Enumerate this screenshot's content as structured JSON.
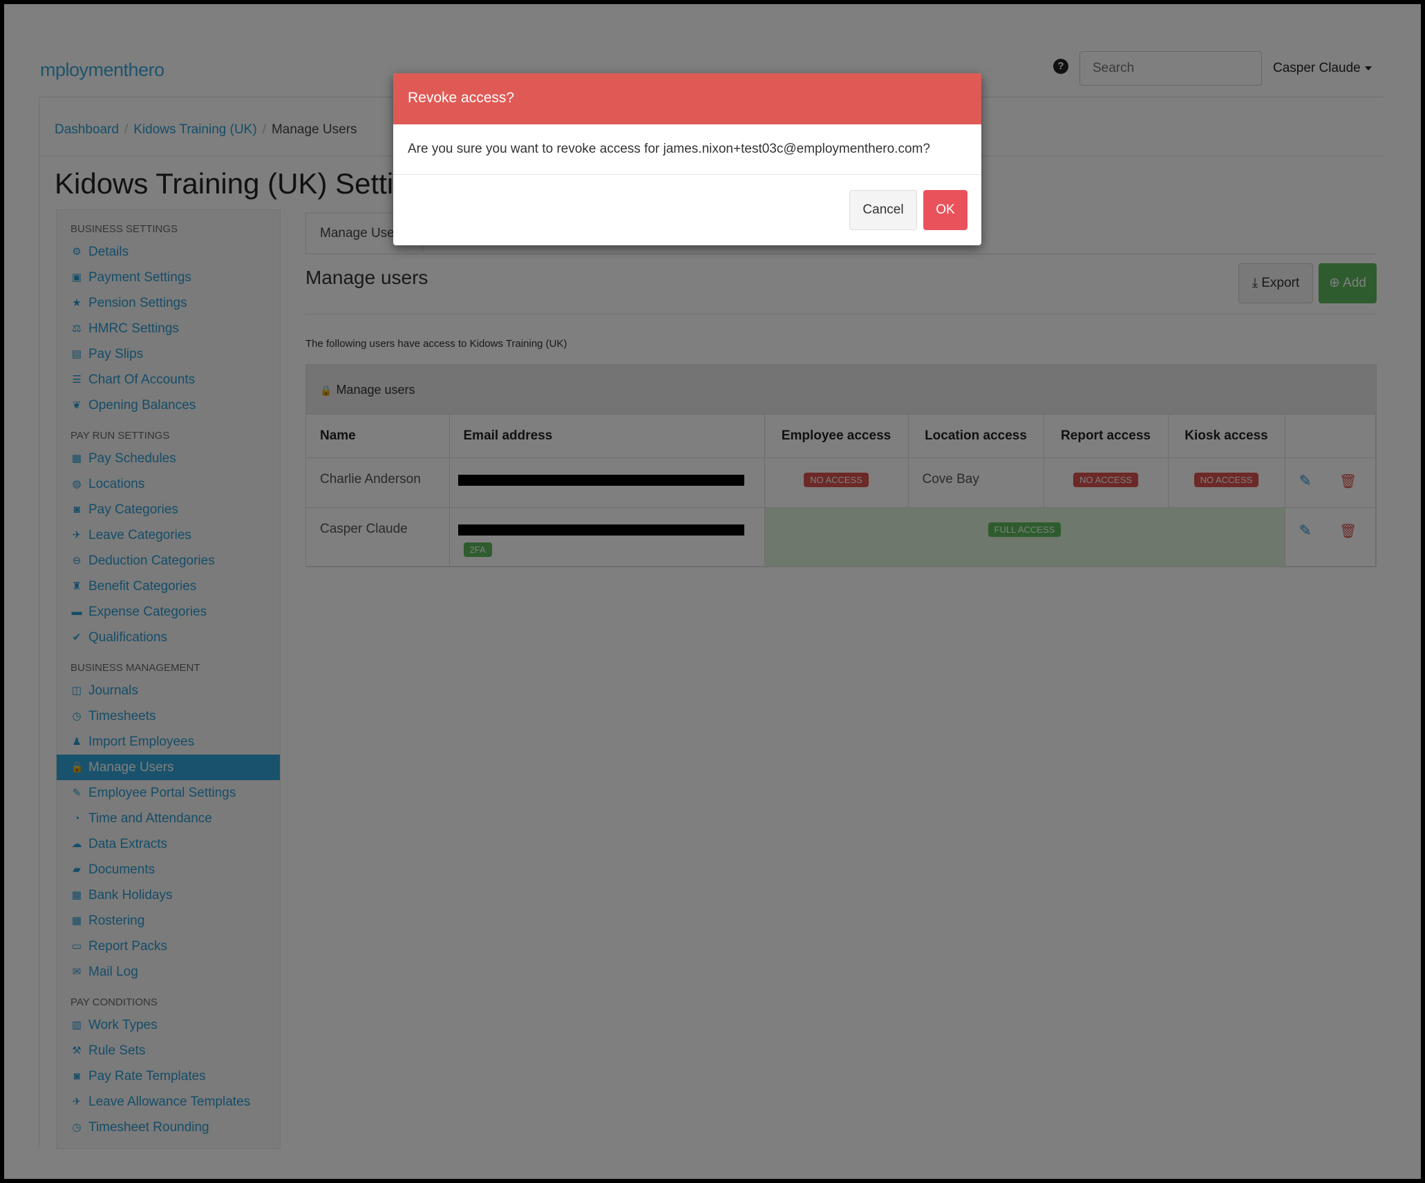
{
  "header": {
    "logo_text": "mploymenthero",
    "help_icon": "?",
    "search_placeholder": "Search",
    "user_name": "Casper Claude"
  },
  "breadcrumb": {
    "items": [
      "Dashboard",
      "Kidows Training (UK)"
    ],
    "current": "Manage Users",
    "separator": "/"
  },
  "page_title": "Kidows Training (UK) Setti",
  "sidebar": {
    "sections": [
      {
        "title": "BUSINESS SETTINGS",
        "items": [
          {
            "label": "Details",
            "icon": "gear-icon",
            "glyph": "⚙"
          },
          {
            "label": "Payment Settings",
            "icon": "save-icon",
            "glyph": "▣"
          },
          {
            "label": "Pension Settings",
            "icon": "star-icon",
            "glyph": "★"
          },
          {
            "label": "HMRC Settings",
            "icon": "scale-icon",
            "glyph": "⚖"
          },
          {
            "label": "Pay Slips",
            "icon": "file-icon",
            "glyph": "▤"
          },
          {
            "label": "Chart Of Accounts",
            "icon": "list-icon",
            "glyph": "☰"
          },
          {
            "label": "Opening Balances",
            "icon": "leaf-icon",
            "glyph": "❦"
          }
        ]
      },
      {
        "title": "PAY RUN SETTINGS",
        "items": [
          {
            "label": "Pay Schedules",
            "icon": "calendar-icon",
            "glyph": "▦"
          },
          {
            "label": "Locations",
            "icon": "globe-icon",
            "glyph": "◍"
          },
          {
            "label": "Pay Categories",
            "icon": "money-icon",
            "glyph": "◙"
          },
          {
            "label": "Leave Categories",
            "icon": "plane-icon",
            "glyph": "✈"
          },
          {
            "label": "Deduction Categories",
            "icon": "minus-circle-icon",
            "glyph": "⊖"
          },
          {
            "label": "Benefit Categories",
            "icon": "gift-icon",
            "glyph": "♜"
          },
          {
            "label": "Expense Categories",
            "icon": "archive-icon",
            "glyph": "▬"
          },
          {
            "label": "Qualifications",
            "icon": "check-icon",
            "glyph": "✔"
          }
        ]
      },
      {
        "title": "BUSINESS MANAGEMENT",
        "items": [
          {
            "label": "Journals",
            "icon": "book-icon",
            "glyph": "◫"
          },
          {
            "label": "Timesheets",
            "icon": "clock-icon",
            "glyph": "◷"
          },
          {
            "label": "Import Employees",
            "icon": "users-icon",
            "glyph": "♟"
          },
          {
            "label": "Manage Users",
            "icon": "lock-icon",
            "glyph": "🔒",
            "active": true
          },
          {
            "label": "Employee Portal Settings",
            "icon": "magic-wand-icon",
            "glyph": "✎"
          },
          {
            "label": "Time and Attendance",
            "icon": "user-clock-icon",
            "glyph": "◔"
          },
          {
            "label": "Data Extracts",
            "icon": "cloud-download-icon",
            "glyph": "☁"
          },
          {
            "label": "Documents",
            "icon": "folder-icon",
            "glyph": "▰"
          },
          {
            "label": "Bank Holidays",
            "icon": "calendar-icon",
            "glyph": "▦"
          },
          {
            "label": "Rostering",
            "icon": "calendar-grid-icon",
            "glyph": "▦"
          },
          {
            "label": "Report Packs",
            "icon": "folder-open-icon",
            "glyph": "▭"
          },
          {
            "label": "Mail Log",
            "icon": "envelope-icon",
            "glyph": "✉"
          }
        ]
      },
      {
        "title": "PAY CONDITIONS",
        "items": [
          {
            "label": "Work Types",
            "icon": "book-icon",
            "glyph": "▥"
          },
          {
            "label": "Rule Sets",
            "icon": "gavel-icon",
            "glyph": "⚒"
          },
          {
            "label": "Pay Rate Templates",
            "icon": "money-icon",
            "glyph": "◙"
          },
          {
            "label": "Leave Allowance Templates",
            "icon": "plane-icon",
            "glyph": "✈"
          },
          {
            "label": "Timesheet Rounding",
            "icon": "clock-icon",
            "glyph": "◷"
          }
        ]
      }
    ]
  },
  "content": {
    "tab_label": "Manage Use",
    "section_title": "Manage users",
    "export_label": "Export",
    "add_label": "Add",
    "intro_text": "The following users have access to Kidows Training (UK)",
    "panel_title": "Manage users",
    "table": {
      "headers": [
        "Name",
        "Email address",
        "Employee access",
        "Location access",
        "Report access",
        "Kiosk access"
      ],
      "rows": [
        {
          "name": "Charlie Anderson",
          "employee_access": "NO ACCESS",
          "location_access": "Cove Bay",
          "report_access": "NO ACCESS",
          "kiosk_access": "NO ACCESS"
        },
        {
          "name": "Casper Claude",
          "badge_2fa": "2FA",
          "full_access": "FULL ACCESS"
        }
      ]
    }
  },
  "modal": {
    "title": "Revoke access?",
    "message": "Are you sure you want to revoke access for james.nixon+test03c@employmenthero.com?",
    "cancel_label": "Cancel",
    "ok_label": "OK"
  },
  "colors": {
    "brand": "#2a9bd0",
    "danger": "#d9534f",
    "success": "#5cb85c",
    "modal_header": "#e05a55",
    "ok_button": "#e9525a"
  }
}
